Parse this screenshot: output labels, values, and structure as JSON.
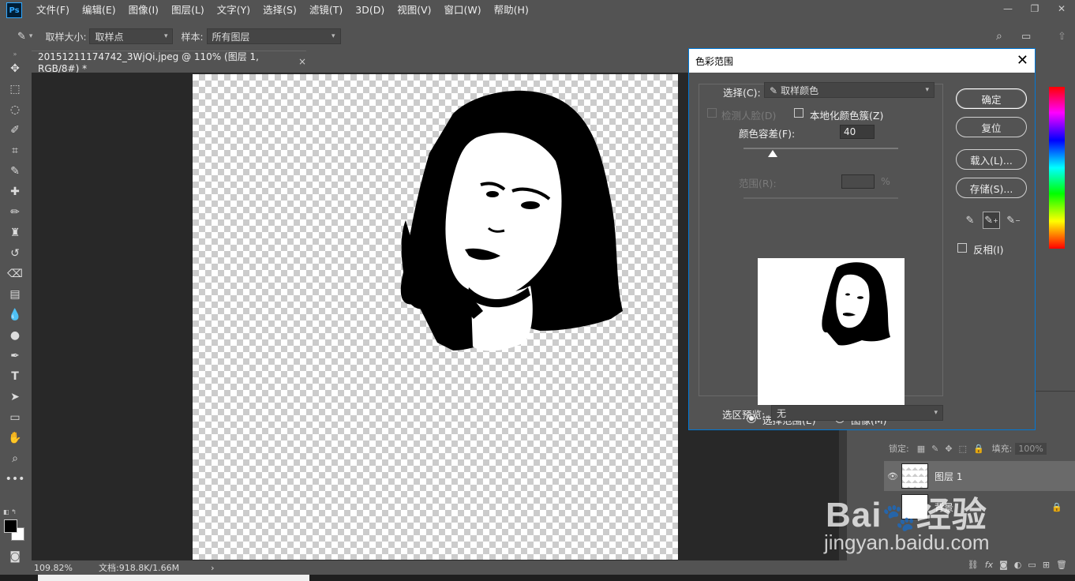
{
  "menu": [
    "文件(F)",
    "编辑(E)",
    "图像(I)",
    "图层(L)",
    "文字(Y)",
    "选择(S)",
    "滤镜(T)",
    "3D(D)",
    "视图(V)",
    "窗口(W)",
    "帮助(H)"
  ],
  "app_logo": "Ps",
  "window_controls": {
    "minimize": "—",
    "restore": "❐",
    "close": "✕"
  },
  "options": {
    "sample_size_label": "取样大小:",
    "sample_size_value": "取样点",
    "sample_label": "样本:",
    "sample_value": "所有图层"
  },
  "document": {
    "tab_title": "20151211174742_3WjQi.jpeg @ 110% (图层 1, RGB/8#) *",
    "close": "×",
    "zoom": "109.82%",
    "doc_size": "文档:918.8K/1.66M",
    "status_arrow": "›"
  },
  "dialog": {
    "title": "色彩范围",
    "close": "✕",
    "select_label": "选择(C):",
    "select_value": "取样颜色",
    "detect_faces": "检测人脸(D)",
    "localized_clusters": "本地化颜色簇(Z)",
    "fuzziness_label": "颜色容差(F):",
    "fuzziness_value": "40",
    "range_label": "范围(R):",
    "range_unit": "%",
    "radio_selection": "选择范围(E)",
    "radio_image": "图像(M)",
    "selection_preview_label": "选区预览:",
    "selection_preview_value": "无",
    "ok": "确定",
    "reset": "复位",
    "load": "载入(L)...",
    "save": "存储(S)...",
    "invert": "反相(I)",
    "fuzziness_fraction": 0.19
  },
  "layers": {
    "lock_label": "锁定:",
    "fill_label": "填充:",
    "fill_value": "100%",
    "items": [
      {
        "name": "图层 1"
      },
      {
        "name": "背景"
      }
    ]
  },
  "watermark": {
    "brand": "Bai",
    "brand_cn": "经验",
    "url": "jingyan.baidu.com"
  },
  "colors": {
    "accent": "#0078d7",
    "ps_blue": "#31a8ff",
    "panel": "#535353",
    "workspace": "#282828"
  }
}
